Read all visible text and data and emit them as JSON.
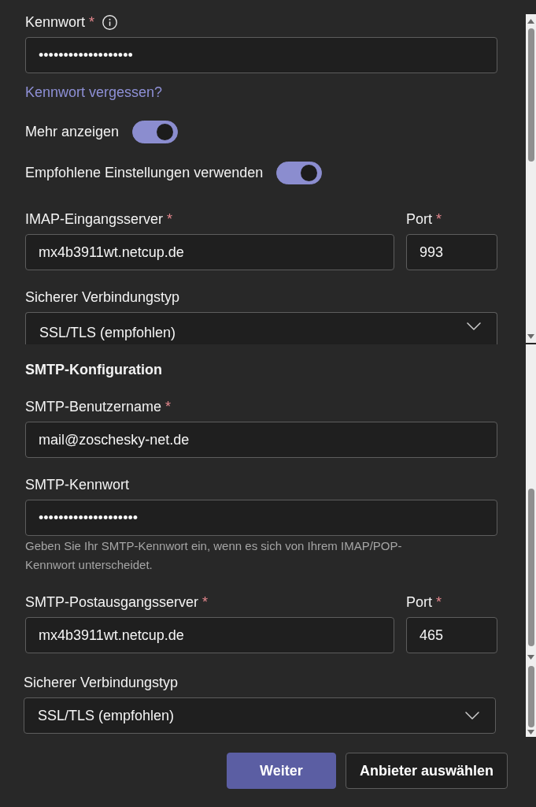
{
  "segments": [
    {
      "items": [
        {
          "kind": "field",
          "label": "Kennwort",
          "required_mark": "*",
          "info": true,
          "value": "•••••••••••••••••••"
        },
        {
          "kind": "link",
          "text": "Kennwort vergessen?"
        },
        {
          "kind": "toggle",
          "label": "Mehr anzeigen",
          "on": true
        },
        {
          "kind": "toggle",
          "label": "Empfohlene Einstellungen verwenden",
          "on": true
        },
        {
          "kind": "field_pair",
          "fields": [
            {
              "label": "IMAP-Eingangsserver",
              "required_mark": "*",
              "value": "mx4b3911wt.netcup.de"
            },
            {
              "label": "Port",
              "required_mark": "*",
              "value": "993"
            }
          ]
        },
        {
          "kind": "select",
          "label": "Sicherer Verbindungstyp",
          "value": "SSL/TLS (empfohlen)"
        }
      ]
    },
    {
      "items": [
        {
          "kind": "heading",
          "text": "SMTP-Konfiguration"
        },
        {
          "kind": "field",
          "label": "SMTP-Benutzername",
          "required_mark": "*",
          "value": "mail@zoschesky-net.de"
        },
        {
          "kind": "field",
          "label": "SMTP-Kennwort",
          "value": "••••••••••••••••••••",
          "help": "Geben Sie Ihr SMTP-Kennwort ein, wenn es sich von Ihrem IMAP/POP-Kennwort unterscheidet."
        },
        {
          "kind": "field_pair",
          "fields": [
            {
              "label": "SMTP-Postausgangsserver",
              "required_mark": "*",
              "value": "mx4b3911wt.netcup.de"
            },
            {
              "label": "Port",
              "required_mark": "*",
              "value": "465"
            }
          ]
        }
      ]
    },
    {
      "items": [
        {
          "kind": "select",
          "label": "Sicherer Verbindungstyp",
          "value": "SSL/TLS (empfohlen)"
        }
      ]
    }
  ],
  "buttons": [
    {
      "label": "Weiter",
      "primary": true
    },
    {
      "label": "Anbieter auswählen",
      "primary": false
    }
  ]
}
